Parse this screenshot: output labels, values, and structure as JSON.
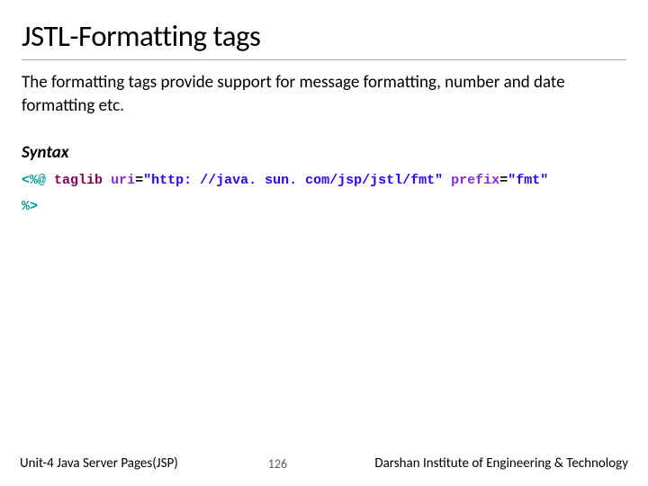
{
  "title": "JSTL-Formatting tags",
  "description": "The formatting tags provide support for message formatting, number and date formatting etc.",
  "syntax_label": "Syntax",
  "code": {
    "open_delim": "<%@",
    "taglib_kw": "taglib",
    "uri_attr": "uri",
    "eq": "=",
    "uri_val": "\"http: //java. sun. com/jsp/jstl/fmt\"",
    "prefix_attr": "prefix",
    "prefix_val": "\"fmt\"",
    "close_delim": "%>"
  },
  "footer": {
    "left": "Unit-4 Java Server Pages(JSP)",
    "page": "126",
    "right": "Darshan Institute of Engineering & Technology"
  }
}
